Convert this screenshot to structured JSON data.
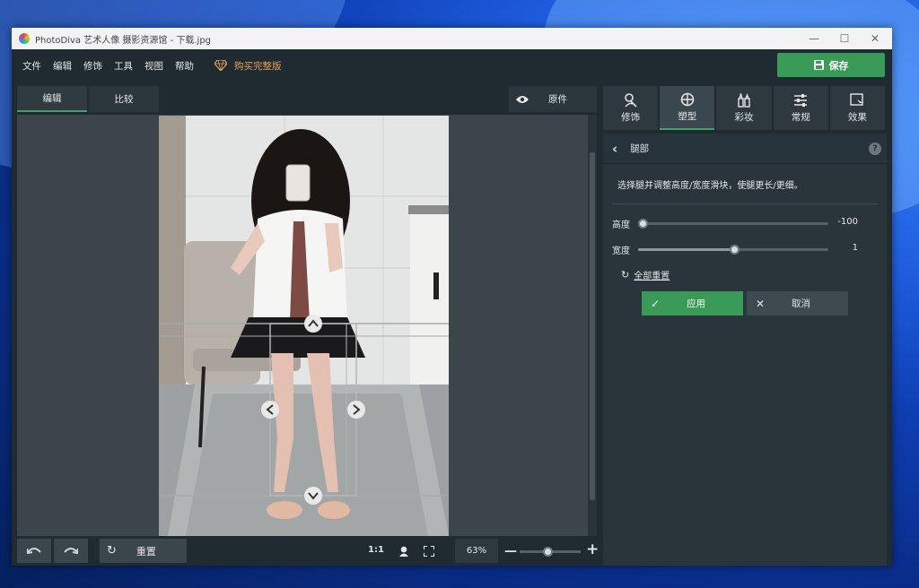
{
  "window": {
    "title": "PhotoDiva 艺术人像 摄影资源馆 - 下载.jpg"
  },
  "menu": [
    "文件",
    "编辑",
    "修饰",
    "工具",
    "视图",
    "帮助"
  ],
  "buy_label": "购买完整版",
  "save_label": "保存",
  "left_tabs": {
    "edit": "编辑",
    "compare": "比较"
  },
  "original_label": "原件",
  "bottom": {
    "reset_label": "重置",
    "ratio_label": "1:1",
    "zoom_value": "63%",
    "zoom_level": 0.45
  },
  "right_tabs": [
    {
      "label": "修饰",
      "icon": "retouch-icon"
    },
    {
      "label": "塑型",
      "icon": "reshape-icon"
    },
    {
      "label": "彩妆",
      "icon": "makeup-icon"
    },
    {
      "label": "常规",
      "icon": "adjust-icon"
    },
    {
      "label": "效果",
      "icon": "effects-icon"
    }
  ],
  "panel": {
    "title": "腿部",
    "help": "?",
    "description": "选择腿并调整高度/宽度滑块，使腿更长/更细。",
    "sliders": [
      {
        "label": "高度",
        "value": "-100",
        "fraction": 0.0
      },
      {
        "label": "宽度",
        "value": "1",
        "fraction": 0.505
      }
    ],
    "reset_all": "全部重置",
    "apply": "应用",
    "cancel": "取消"
  },
  "colors": {
    "accent": "#3a9a57",
    "buy": "#e8a15a",
    "bg": "#1f2b31"
  }
}
